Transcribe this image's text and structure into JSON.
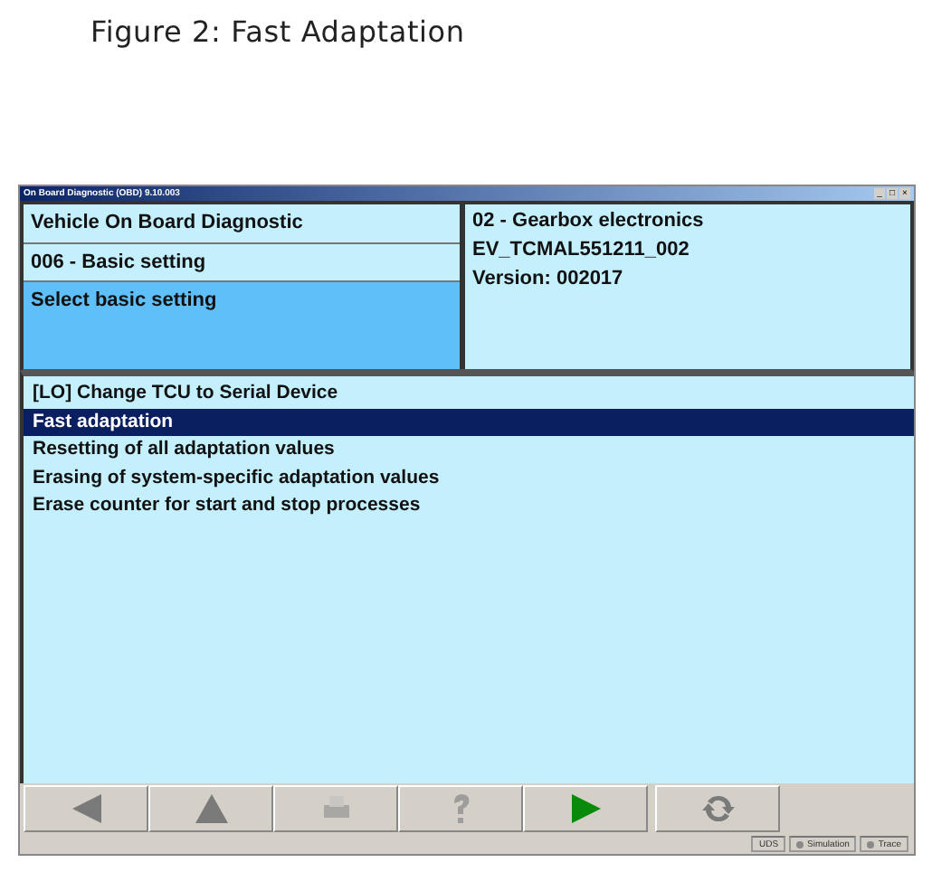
{
  "caption": "Figure 2: Fast Adaptation",
  "window": {
    "title": "On Board Diagnostic (OBD) 9.10.003",
    "controls": [
      "_",
      "□",
      "×"
    ]
  },
  "left_panel": {
    "items": [
      {
        "label": "Vehicle On Board Diagnostic",
        "selected": false
      },
      {
        "label": "006 - Basic setting",
        "selected": false
      },
      {
        "label": "Select basic setting",
        "selected": true
      }
    ]
  },
  "right_panel": {
    "lines": [
      "02 - Gearbox electronics",
      "EV_TCMAL551211_002",
      "Version: 002017"
    ]
  },
  "list": {
    "items": [
      {
        "label": "[LO] Change TCU to Serial Device",
        "selected": false
      },
      {
        "label": "Fast adaptation",
        "selected": true
      },
      {
        "label": "Resetting of all adaptation values",
        "selected": false
      },
      {
        "label": "Erasing of system-specific adaptation values",
        "selected": false
      },
      {
        "label": "Erase counter for start and stop processes",
        "selected": false
      }
    ]
  },
  "toolbar": [
    {
      "kind": "back",
      "disabled": true
    },
    {
      "kind": "up",
      "disabled": true
    },
    {
      "kind": "print",
      "disabled": true
    },
    {
      "kind": "help",
      "disabled": true
    },
    {
      "kind": "forward",
      "disabled": false
    },
    {
      "kind": "refresh",
      "disabled": true
    }
  ],
  "status_bar": [
    {
      "label": "UDS",
      "kind": "text"
    },
    {
      "label": "Simulation",
      "kind": "led"
    },
    {
      "label": "Trace",
      "kind": "led"
    }
  ]
}
